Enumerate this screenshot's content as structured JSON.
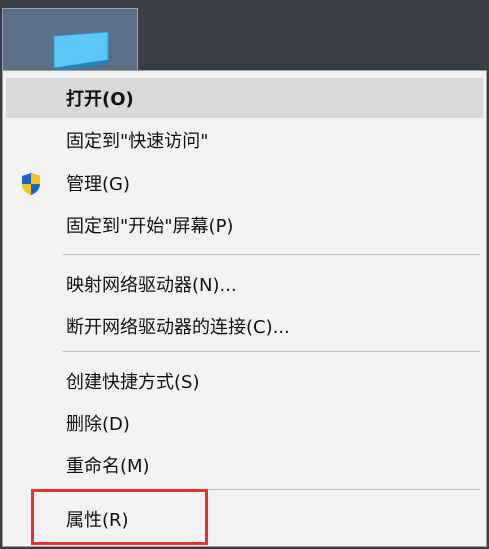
{
  "desktop": {
    "icon_name": "monitor-icon"
  },
  "menu": {
    "items": [
      {
        "label": "打开(O)"
      },
      {
        "label": "固定到\"快速访问\""
      },
      {
        "label": "管理(G)",
        "icon": "admin-shield-icon"
      },
      {
        "label": "固定到\"开始\"屏幕(P)"
      },
      {
        "label": "映射网络驱动器(N)..."
      },
      {
        "label": "断开网络驱动器的连接(C)..."
      },
      {
        "label": "创建快捷方式(S)"
      },
      {
        "label": "删除(D)"
      },
      {
        "label": "重命名(M)"
      },
      {
        "label": "属性(R)"
      }
    ]
  },
  "colors": {
    "menu_bg": "#f2f2f2",
    "hover_bg": "#d9d9d9",
    "highlight_border": "#e23232"
  }
}
